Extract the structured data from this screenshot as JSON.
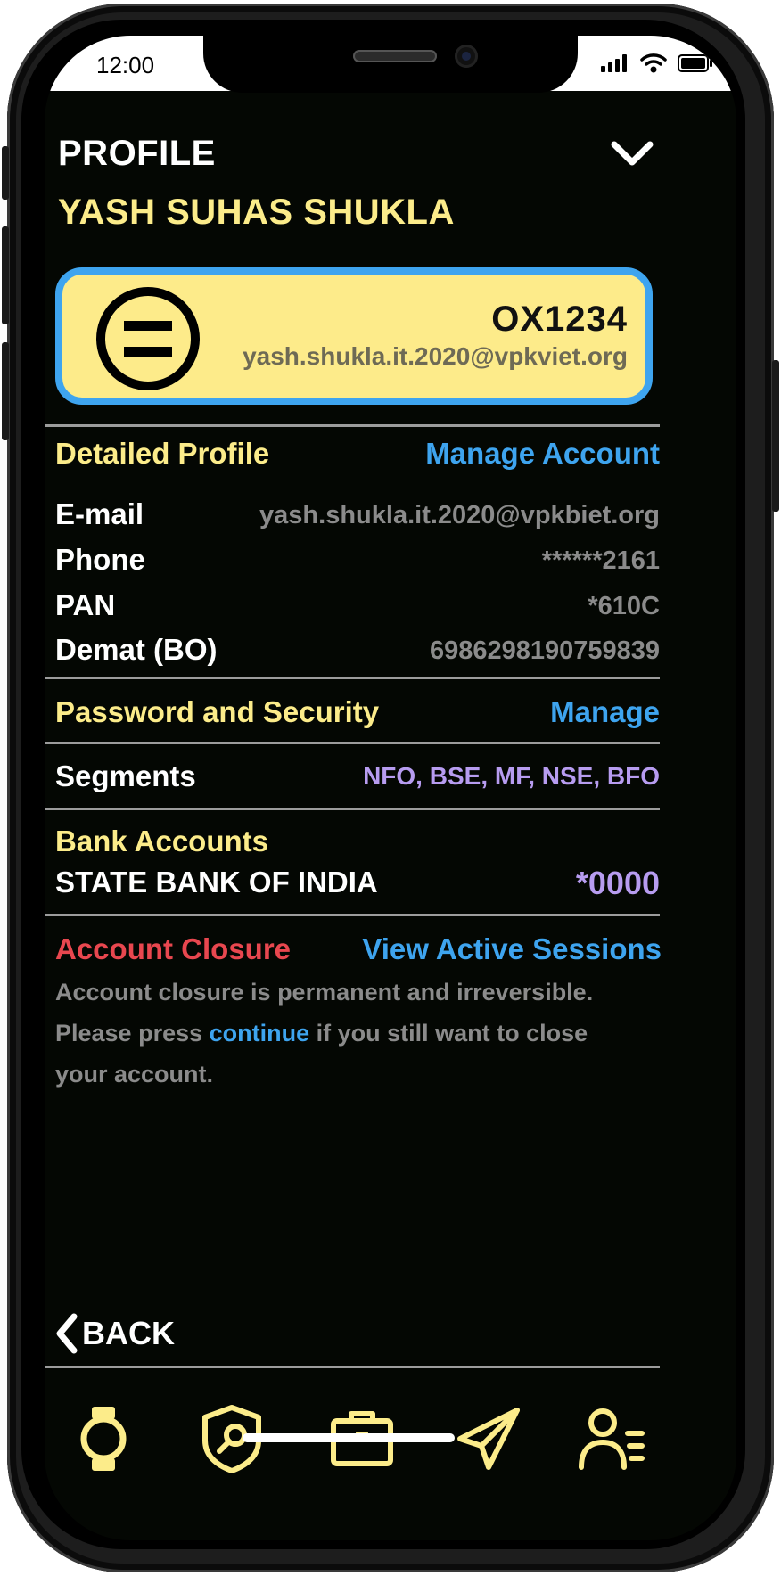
{
  "status_bar": {
    "time": "12:00"
  },
  "header": {
    "title": "PROFILE",
    "user_name": "YASH SUHAS SHUKLA"
  },
  "profile_card": {
    "client_code": "OX1234",
    "email": "yash.shukla.it.2020@vpkviet.org",
    "avatar_icon": "equals-circle-icon"
  },
  "detailed_profile": {
    "title": "Detailed Profile",
    "action": "Manage Account",
    "rows": [
      {
        "label": "E-mail",
        "value": "yash.shukla.it.2020@vpkbiet.org"
      },
      {
        "label": "Phone",
        "value": "******2161"
      },
      {
        "label": "PAN",
        "value": "*610C"
      },
      {
        "label": "Demat (BO)",
        "value": "6986298190759839"
      }
    ]
  },
  "security": {
    "title": "Password and Security",
    "action": "Manage"
  },
  "segments": {
    "label": "Segments",
    "value": "NFO, BSE, MF, NSE, BFO"
  },
  "bank_accounts": {
    "title": "Bank Accounts",
    "bank_name": "STATE BANK OF INDIA",
    "account": "*0000"
  },
  "closure": {
    "title": "Account Closure",
    "action": "View Active Sessions",
    "text_before": "Account closure is permanent and irreversible. Please press ",
    "link": "continue",
    "text_after": " if you still want to close your account."
  },
  "back_label": "BACK",
  "tab_icons": [
    "watch-icon",
    "shield-search-icon",
    "briefcase-icon",
    "paper-plane-icon",
    "user-list-icon"
  ],
  "colors": {
    "background": "#040703",
    "accent_yellow": "#fcec8a",
    "link_blue": "#3ea4ef",
    "purple": "#b79cf0",
    "danger_red": "#e8474f",
    "muted_gray": "#8b8b8b"
  }
}
